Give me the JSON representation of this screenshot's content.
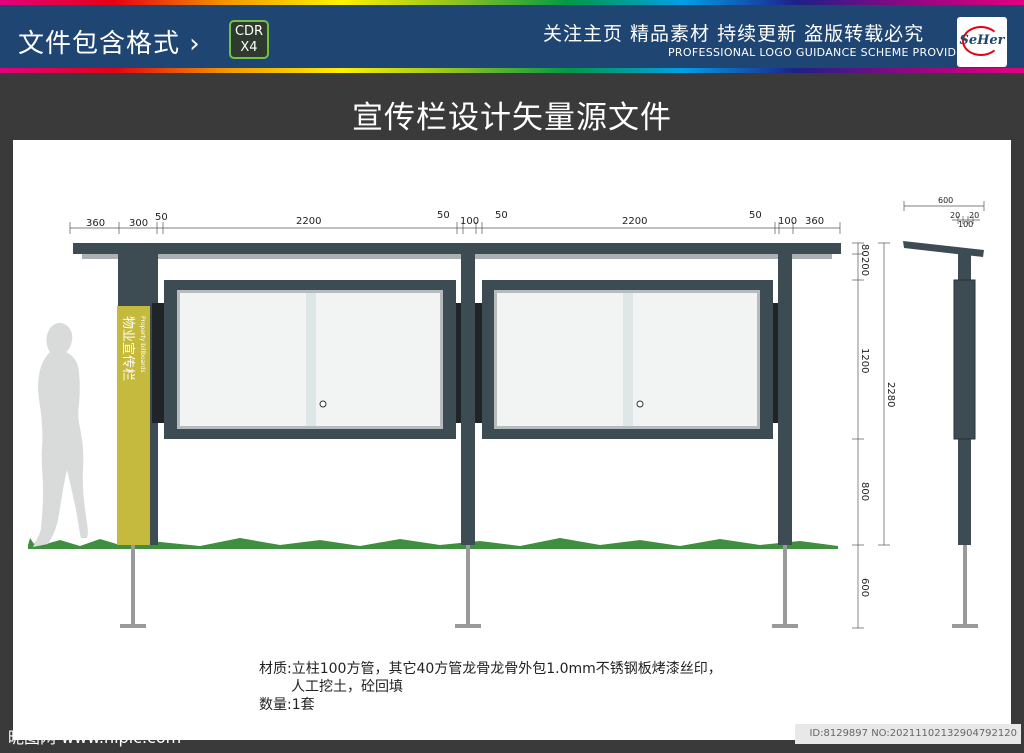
{
  "header": {
    "title": "文件包含格式 ›",
    "badge_line1": "CDR",
    "badge_line2": "X4",
    "slogan": "关注主页  精品素材  持续更新  盗版转载必究",
    "tagline": "PROFESSIONAL LOGO GUIDANCE SCHEME PROVIDER",
    "logo_text": "SeHer"
  },
  "main_title": "宣传栏设计矢量源文件",
  "drawing": {
    "sign_text": "物业宣传栏",
    "sign_subtext": "Property billboards",
    "top_dims": [
      "360",
      "300",
      "50",
      "2200",
      "50",
      "100",
      "50",
      "2200",
      "50",
      "100",
      "360"
    ],
    "side_dims": [
      "80",
      "200",
      "1200",
      "800",
      "600",
      "2280"
    ],
    "side_view_dims": [
      "600",
      "20",
      "20",
      "100"
    ]
  },
  "colors": {
    "frame": "#3d4b52",
    "sign": "#c5b93e",
    "grass": "#3e8f3e",
    "glass": "#f2f4f4",
    "pole": "#9a9a9a"
  },
  "materials": {
    "line1": "材质:立柱100方管，其它40方管龙骨龙骨外包1.0mm不锈钢板烤漆丝印，",
    "line2": "人工挖土，砼回填",
    "line3": "数量:1套"
  },
  "watermarks": {
    "left": "昵图网 www.nipic.com",
    "right": "ID:8129897 NO:20211102132904792120"
  }
}
